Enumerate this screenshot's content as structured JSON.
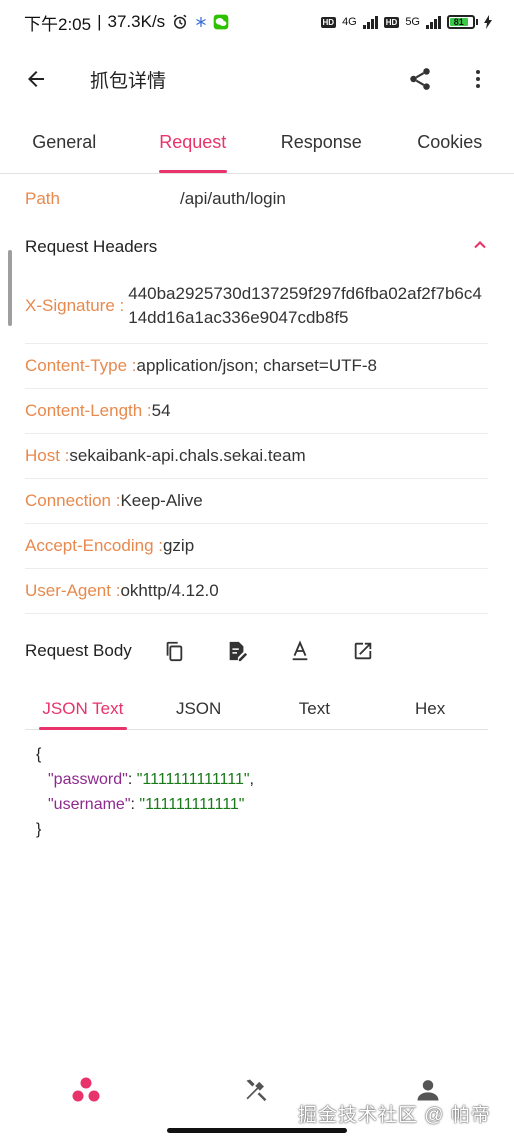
{
  "status_bar": {
    "time": "下午2:05",
    "speed": "37.3K/s",
    "network_1": "4G",
    "network_2": "5G",
    "battery": "81"
  },
  "app_bar": {
    "title": "抓包详情",
    "icons": [
      "back-arrow-icon",
      "share-icon",
      "more-vert-icon"
    ]
  },
  "tabs": [
    {
      "label": "General"
    },
    {
      "label": "Request"
    },
    {
      "label": "Response"
    },
    {
      "label": "Cookies"
    }
  ],
  "active_tab": "Request",
  "path": {
    "label": "Path",
    "value": "/api/auth/login"
  },
  "request_headers": {
    "title": "Request Headers",
    "rows": [
      {
        "key": "X-Signature : ",
        "value": "440ba2925730d137259f297fd6fba02af2f7b6c414dd16a1ac336e9047cdb8f5"
      },
      {
        "key": "Content-Type : ",
        "value": "application/json; charset=UTF-8"
      },
      {
        "key": "Content-Length : ",
        "value": "54"
      },
      {
        "key": "Host : ",
        "value": "sekaibank-api.chals.sekai.team"
      },
      {
        "key": "Connection : ",
        "value": "Keep-Alive"
      },
      {
        "key": "Accept-Encoding : ",
        "value": "gzip"
      },
      {
        "key": "User-Agent : ",
        "value": "okhttp/4.12.0"
      }
    ]
  },
  "request_body": {
    "title": "Request Body",
    "tools": [
      "copy-icon",
      "edit-note-icon",
      "text-format-icon",
      "open-in-new-icon"
    ],
    "sub_tabs": [
      {
        "label": "JSON Text"
      },
      {
        "label": "JSON"
      },
      {
        "label": "Text"
      },
      {
        "label": "Hex"
      }
    ],
    "active_sub_tab": "JSON Text",
    "json": {
      "open": "{",
      "close": "}",
      "lines": [
        {
          "key": "\"password\"",
          "sep": ": ",
          "value": "\"1111111111111\"",
          "comma": ","
        },
        {
          "key": "\"username\"",
          "sep": ": ",
          "value": "\"111111111111\"",
          "comma": ""
        }
      ]
    }
  },
  "bottom_nav": {
    "items": [
      "dots-icon",
      "tools-icon",
      "person-icon"
    ]
  },
  "watermark": "掘金技术社区 @ 帕帝",
  "colors": {
    "accent": "#e8336b",
    "header_key": "#e8894d",
    "json_key": "#8e2a8e",
    "json_string": "#1a7a1a"
  }
}
